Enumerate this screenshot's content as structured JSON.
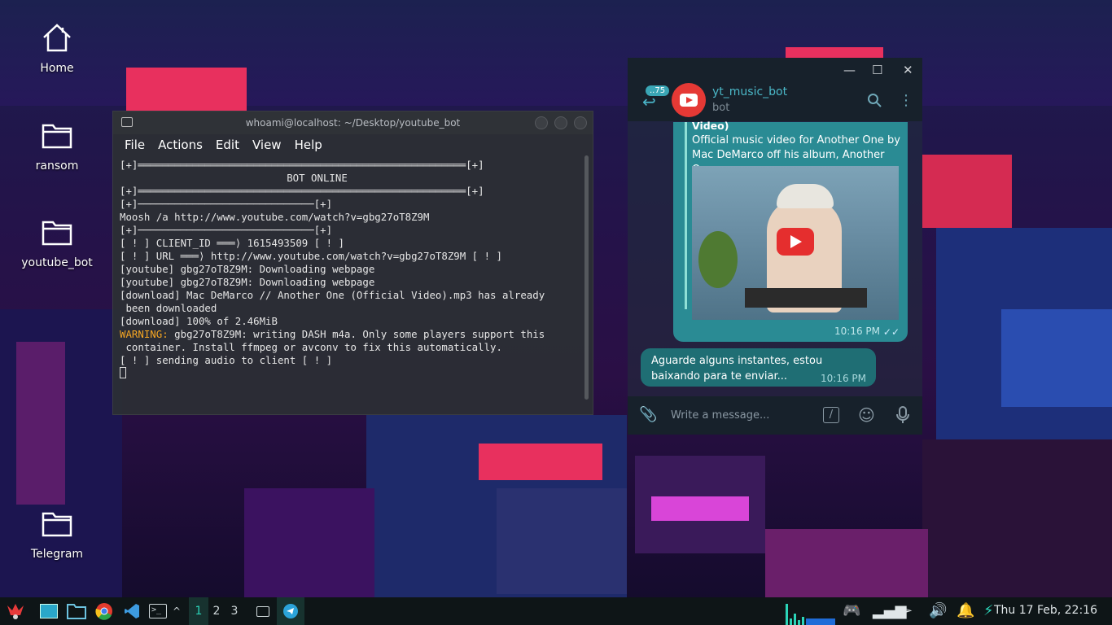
{
  "desktop": {
    "icons": [
      {
        "label": "Home"
      },
      {
        "label": "ransom"
      },
      {
        "label": "youtube_bot"
      },
      {
        "label": "Telegram"
      }
    ]
  },
  "terminal": {
    "title": "whoami@localhost: ~/Desktop/youtube_bot",
    "menu": [
      "File",
      "Actions",
      "Edit",
      "View",
      "Help"
    ],
    "lines": [
      "[+]══════════════════════════════════════════════════════[+]",
      "BOT ONLINE",
      "[+]══════════════════════════════════════════════════════[+]",
      "[+]─────────────────────────────[+]",
      "Moosh /a http://www.youtube.com/watch?v=gbg27oT8Z9M",
      "[+]─────────────────────────────[+]",
      "[ ! ] CLIENT_ID ═══⟩ 1615493509 [ ! ]",
      "[ ! ] URL ═══⟩ http://www.youtube.com/watch?v=gbg27oT8Z9M [ ! ]",
      "[youtube] gbg27oT8Z9M: Downloading webpage",
      "[youtube] gbg27oT8Z9M: Downloading webpage",
      "[download] Mac DeMarco // Another One (Official Video).mp3 has already",
      " been downloaded",
      "[download] 100% of 2.46MiB"
    ],
    "warning_label": "WARNING:",
    "warning_text": " gbg27oT8Z9M: writing DASH m4a. Only some players support this",
    "warning_cont": " container. Install ffmpeg or avconv to fix this automatically.",
    "last_line": "[ ! ] sending audio to client [ ! ]"
  },
  "telegram": {
    "window_controls": {
      "minimize": "—",
      "maximize": "☐",
      "close": "✕"
    },
    "unread_badge": "..75",
    "chat_name": "yt_music_bot",
    "chat_status": "bot",
    "media_message": {
      "title_fragment": "Video)",
      "description": "Official music video for Another One by Mac DeMarco off his album, Another On...",
      "time": "10:16 PM"
    },
    "text_message": {
      "text": "Aguarde alguns instantes, estou baixando para te enviar...",
      "time": "10:16 PM"
    },
    "input_placeholder": "Write a message...",
    "command_icon": "/"
  },
  "taskbar": {
    "workspaces": [
      "1",
      "2",
      "3"
    ],
    "active_workspace": "1",
    "clock": "Thu 17 Feb, 22:16",
    "accent": "#2bd4b8"
  }
}
